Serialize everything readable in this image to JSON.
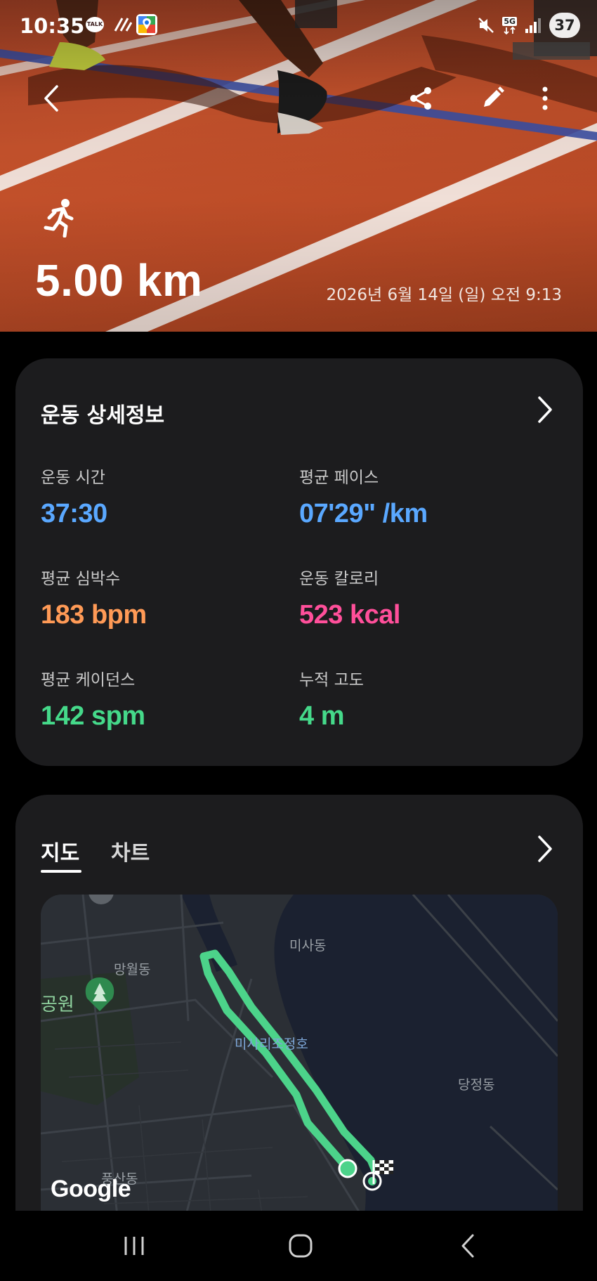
{
  "status_bar": {
    "time": "10:35",
    "talk_badge": "TALK",
    "network": "5G",
    "battery": "37"
  },
  "hero": {
    "distance": "5.00 km",
    "datetime": "2026년 6월 14일 (일) 오전 9:13",
    "icons": [
      "back-arrow-icon",
      "share-icon",
      "edit-pencil-icon",
      "more-vertical-icon",
      "running-person-icon"
    ]
  },
  "details": {
    "title": "운동 상세정보",
    "stats": [
      {
        "label": "운동 시간",
        "value": "37:30",
        "color": "#5aa8ff"
      },
      {
        "label": "평균 페이스",
        "value": "07'29\" /km",
        "color": "#5aa8ff"
      },
      {
        "label": "평균 심박수",
        "value": "183 bpm",
        "color": "#ff9a56"
      },
      {
        "label": "운동 칼로리",
        "value": "523 kcal",
        "color": "#ff4f9a"
      },
      {
        "label": "평균 케이던스",
        "value": "142 spm",
        "color": "#45d98a"
      },
      {
        "label": "누적 고도",
        "value": "4 m",
        "color": "#45d98a"
      }
    ]
  },
  "map_card": {
    "tabs": [
      {
        "label": "지도",
        "active": true
      },
      {
        "label": "차트",
        "active": false
      }
    ],
    "map_labels": {
      "mangwol": "망월동",
      "park": "공원",
      "misa": "미사동",
      "lake": "미사리조정호",
      "dangjeong": "당정동",
      "pungsan": "풍산동"
    },
    "attribution": "Google",
    "route_color": "#4cd38a"
  },
  "nav_bar": {
    "icons": [
      "recent-apps-icon",
      "home-icon",
      "back-icon"
    ]
  }
}
